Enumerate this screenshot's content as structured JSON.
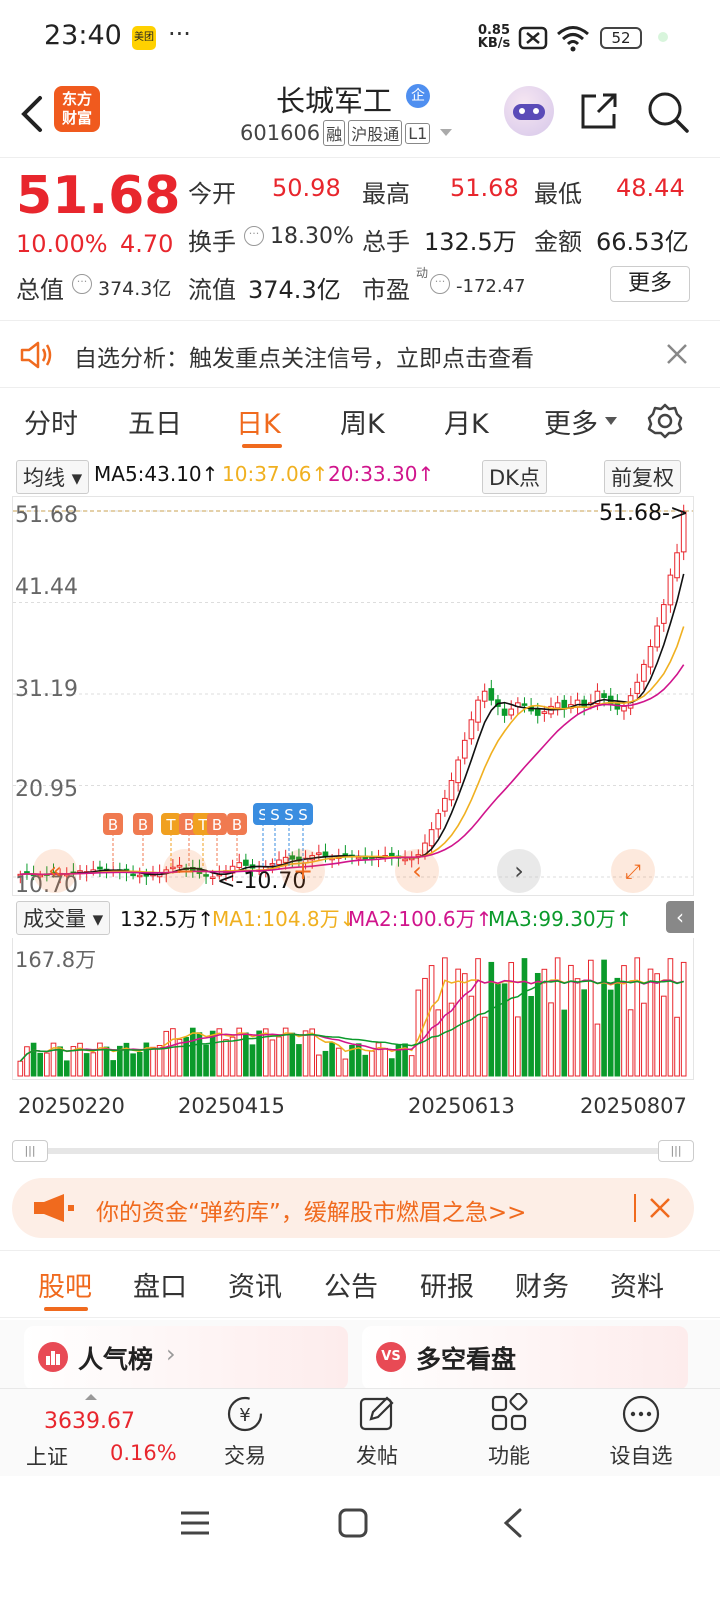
{
  "status_bar": {
    "time": "23:40",
    "app_badge": "美团",
    "more": "···",
    "net_speed_top": "0.85",
    "net_speed_unit": "KB/s",
    "battery": "52"
  },
  "header": {
    "back_icon": "chevron-left-icon",
    "logo_line1": "东方",
    "logo_line2": "财富",
    "stock_name": "长城军工",
    "enterprise_badge": "企",
    "stock_code": "601606",
    "tags": [
      "融",
      "沪股通",
      "L1"
    ]
  },
  "quote": {
    "price": "51.68",
    "change_pct": "10.00%",
    "change_amt": "4.70",
    "open_label": "今开",
    "open_value": "50.98",
    "high_label": "最高",
    "high_value": "51.68",
    "low_label": "最低",
    "low_value": "48.44",
    "turnover_label": "换手",
    "turnover_value": "18.30%",
    "volume_label": "总手",
    "volume_value": "132.5万",
    "amount_label": "金额",
    "amount_value": "66.53亿",
    "mktcap_label": "总值",
    "mktcap_value": "374.3亿",
    "float_label": "流值",
    "float_value": "374.3亿",
    "pe_label": "市盈",
    "pe_sup": "动",
    "pe_value": "-172.47",
    "more_button": "更多"
  },
  "notice": {
    "text": "自选分析：触发重点关注信号，立即点击查看"
  },
  "period_tabs": [
    "分时",
    "五日",
    "日K",
    "周K",
    "月K",
    "更多"
  ],
  "period_active": "日K",
  "ma_legend": {
    "selector": "均线",
    "ma5": "MA5:43.10",
    "ma10": "10:37.06",
    "ma20": "20:33.30",
    "dk_button": "DK点",
    "adjust_button": "前复权"
  },
  "chart_data": {
    "type": "candlestick",
    "y_ticks": [
      "51.68",
      "41.44",
      "31.19",
      "20.95",
      "10.70"
    ],
    "ylim": [
      10.7,
      51.68
    ],
    "last_price_marker": "51.68->",
    "low_marker": "<-10.70",
    "signal_labels": [
      "B",
      "B",
      "T",
      "B",
      "T",
      "B",
      "B",
      "S",
      "S",
      "S",
      "S"
    ],
    "x_tick_labels": [
      "20250220",
      "20250415",
      "20250613",
      "20250807"
    ],
    "close_series": [
      11.0,
      11.1,
      11.0,
      10.9,
      11.0,
      11.2,
      11.1,
      11.0,
      11.2,
      11.4,
      11.3,
      11.5,
      11.6,
      11.5,
      11.4,
      11.3,
      11.2,
      11.0,
      10.9,
      10.8,
      11.0,
      11.2,
      11.5,
      11.8,
      12.0,
      11.7,
      11.4,
      11.1,
      10.9,
      10.7,
      11.0,
      11.4,
      11.9,
      12.3,
      12.0,
      11.7,
      11.5,
      11.8,
      12.2,
      12.6,
      12.9,
      12.7,
      12.5,
      12.8,
      13.1,
      13.4,
      13.0,
      12.8,
      13.0,
      13.2,
      13.1,
      12.9,
      12.7,
      12.9,
      13.0,
      13.1,
      12.9,
      12.8,
      12.7,
      12.8,
      13.2,
      14.5,
      16.0,
      17.8,
      19.5,
      21.5,
      23.8,
      26.0,
      28.3,
      30.5,
      31.5,
      30.5,
      29.8,
      28.8,
      29.5,
      30.2,
      30.0,
      29.3,
      28.8,
      29.2,
      29.8,
      30.2,
      29.5,
      30.0,
      30.5,
      29.8,
      30.2,
      31.5,
      30.8,
      30.0,
      29.5,
      29.8,
      31.0,
      32.5,
      34.5,
      36.5,
      38.8,
      41.2,
      44.5,
      47.0,
      51.68
    ],
    "ma5_last": 43.1,
    "ma10_last": 37.06,
    "ma20_last": 33.3
  },
  "volume_legend": {
    "selector": "成交量",
    "vol": "132.5万",
    "ma1": "MA1:104.8万",
    "ma2": "MA2:100.6万",
    "ma3": "MA3:99.30万",
    "max_label": "167.8万"
  },
  "promo": {
    "text": "你的资金“弹药库”，缓解股市燃眉之急>>"
  },
  "bottom_tabs": [
    "股吧",
    "盘口",
    "资讯",
    "公告",
    "研报",
    "财务",
    "资料"
  ],
  "bottom_tab_active": "股吧",
  "cards": {
    "popular": "人气榜",
    "bull_bear": "多空看盘"
  },
  "bottom_bar": {
    "index_value": "3639.67",
    "index_name": "上证",
    "index_change": "0.16%",
    "trade": "交易",
    "post": "发帖",
    "functions": "功能",
    "watchlist": "设自选"
  },
  "colors": {
    "up": "#e8262d",
    "down": "#0b9a2b",
    "ma5": "#111111",
    "ma10": "#f0b020",
    "ma20": "#d0148c",
    "accent": "#f06a1e"
  }
}
